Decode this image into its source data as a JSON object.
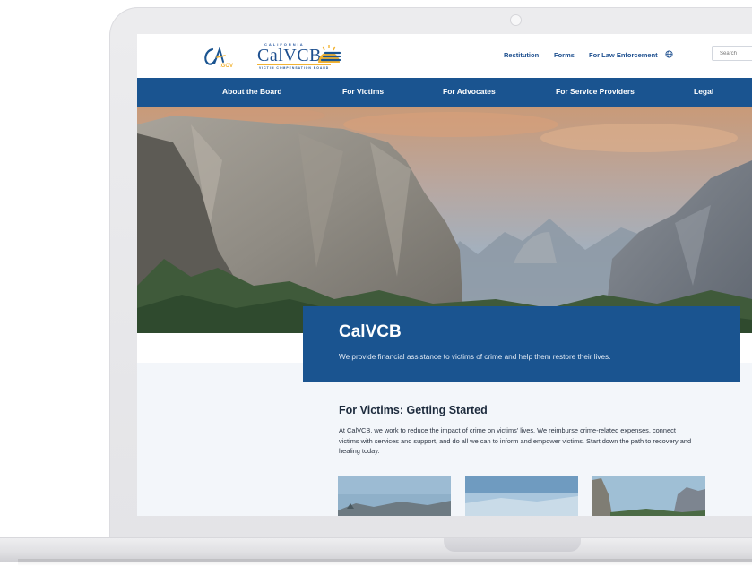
{
  "header": {
    "ca_gov_logo_text": "CA.GOV",
    "brand": {
      "top_text": "CALIFORNIA",
      "name": "CalVCB",
      "subtitle": "VICTIM COMPENSATION BOARD"
    },
    "utility_links": [
      "Restitution",
      "Forms",
      "For Law Enforcement"
    ],
    "search_placeholder": "Search"
  },
  "main_nav": [
    "About the Board",
    "For Victims",
    "For Advocates",
    "For Service Providers",
    "Legal"
  ],
  "banner": {
    "title": "CalVCB",
    "text": "We provide financial assistance to victims of crime and help them restore their lives."
  },
  "section": {
    "title": "For Victims: Getting Started",
    "text": "At CalVCB, we work to reduce the impact of crime on victims' lives. We reimburse crime-related expenses, connect victims with services and support, and do all we can to inform and empower victims. Start down the path to recovery and healing today."
  },
  "colors": {
    "nav_blue": "#1a5490",
    "brand_gold": "#f2b333",
    "page_bg_light": "#f3f6fa"
  },
  "icons": {
    "language": "globe-icon"
  }
}
